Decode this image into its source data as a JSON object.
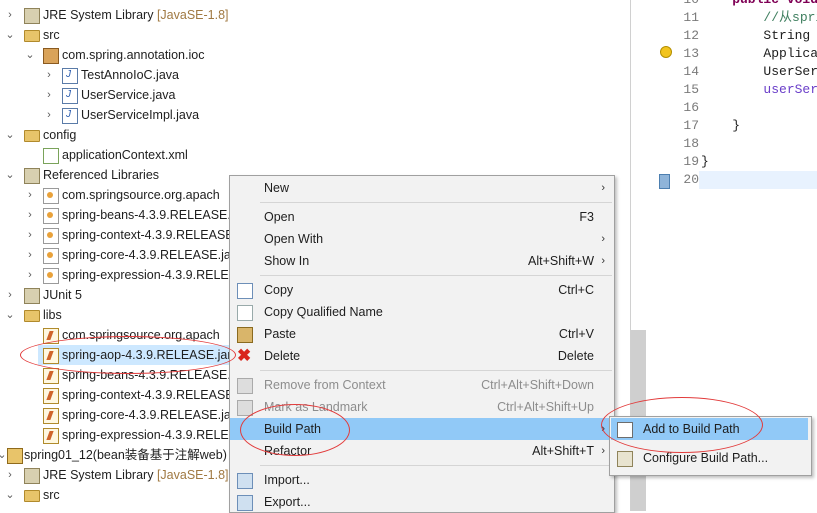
{
  "tree": {
    "rows": [
      {
        "label": "JRE System Library",
        "decoration": "[JavaSE-1.8]",
        "icon": "library-icon"
      },
      {
        "label": "src",
        "icon": "source-folder-icon"
      },
      {
        "label": "com.spring.annotation.ioc",
        "icon": "package-icon"
      },
      {
        "label": "TestAnnoIoC.java",
        "icon": "java-file-icon"
      },
      {
        "label": "UserService.java",
        "icon": "java-file-icon"
      },
      {
        "label": "UserServiceImpl.java",
        "icon": "java-file-icon"
      },
      {
        "label": "config",
        "icon": "source-folder-icon"
      },
      {
        "label": "applicationContext.xml",
        "icon": "xml-file-icon"
      },
      {
        "label": "Referenced Libraries",
        "icon": "library-icon"
      },
      {
        "label": "com.springsource.org.apach",
        "icon": "jar-icon"
      },
      {
        "label": "spring-beans-4.3.9.RELEASE.j",
        "icon": "jar-icon"
      },
      {
        "label": "spring-context-4.3.9.RELEASE",
        "icon": "jar-icon"
      },
      {
        "label": "spring-core-4.3.9.RELEASE.ja",
        "icon": "jar-icon"
      },
      {
        "label": "spring-expression-4.3.9.RELE",
        "icon": "jar-icon"
      },
      {
        "label": "JUnit 5",
        "icon": "library-icon"
      },
      {
        "label": "libs",
        "icon": "folder-icon"
      },
      {
        "label": "com.springsource.org.apach",
        "icon": "jar-file-icon"
      },
      {
        "label": "spring-aop-4.3.9.RELEASE.jar",
        "icon": "jar-file-icon"
      },
      {
        "label": "spring-beans-4.3.9.RELEASE.j",
        "icon": "jar-file-icon"
      },
      {
        "label": "spring-context-4.3.9.RELEASE",
        "icon": "jar-file-icon"
      },
      {
        "label": "spring-core-4.3.9.RELEASE.ja",
        "icon": "jar-file-icon"
      },
      {
        "label": "spring-expression-4.3.9.RELE",
        "icon": "jar-file-icon"
      },
      {
        "label": "spring01_12(bean装备基于注解web)",
        "icon": "project-icon"
      },
      {
        "label": "JRE System Library",
        "decoration": "[JavaSE-1.8]",
        "icon": "library-icon"
      },
      {
        "label": "src",
        "icon": "source-folder-icon"
      }
    ]
  },
  "editor": {
    "line_numbers": [
      "10",
      "11",
      "12",
      "13",
      "14",
      "15",
      "16",
      "17",
      "18",
      "19",
      "20"
    ],
    "lines": [
      "    public void",
      "        //从spri",
      "        String ",
      "        Applica",
      "        UserSer",
      "        userSer",
      "",
      "    }",
      "",
      "}",
      ""
    ]
  },
  "context_menu": {
    "items": [
      {
        "label": "New",
        "accel": "",
        "submenu": true
      },
      {
        "label": "Open",
        "accel": "F3"
      },
      {
        "label": "Open With",
        "accel": "",
        "submenu": true
      },
      {
        "label": "Show In",
        "accel": "Alt+Shift+W",
        "submenu": true
      },
      {
        "label": "Copy",
        "accel": "Ctrl+C"
      },
      {
        "label": "Copy Qualified Name",
        "accel": ""
      },
      {
        "label": "Paste",
        "accel": "Ctrl+V"
      },
      {
        "label": "Delete",
        "accel": "Delete"
      },
      {
        "label": "Remove from Context",
        "accel": "Ctrl+Alt+Shift+Down"
      },
      {
        "label": "Mark as Landmark",
        "accel": "Ctrl+Alt+Shift+Up"
      },
      {
        "label": "Build Path",
        "accel": "",
        "submenu": true
      },
      {
        "label": "Refactor",
        "accel": "Alt+Shift+T",
        "submenu": true
      },
      {
        "label": "Import...",
        "accel": ""
      },
      {
        "label": "Export...",
        "accel": ""
      }
    ]
  },
  "build_path_submenu": {
    "items": [
      {
        "label": "Add to Build Path"
      },
      {
        "label": "Configure Build Path..."
      }
    ]
  },
  "colors": {
    "selection": "#cde8ff",
    "menu_highlight": "#91c9f7",
    "annotation": "#e23b3b",
    "comment_green": "#3f7f5f",
    "field_blue": "#0000c0",
    "keyword_purple": "#7f0055"
  }
}
